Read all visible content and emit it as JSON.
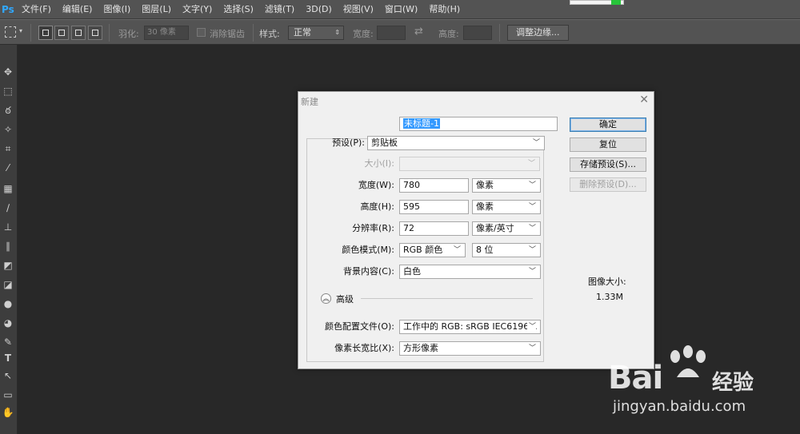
{
  "app": {
    "logo": "Ps"
  },
  "menu": [
    "文件(F)",
    "编辑(E)",
    "图像(I)",
    "图层(L)",
    "文字(Y)",
    "选择(S)",
    "滤镜(T)",
    "3D(D)",
    "视图(V)",
    "窗口(W)",
    "帮助(H)"
  ],
  "options": {
    "feather_label": "羽化:",
    "feather_value": "30 像素",
    "antialias_label": "消除锯齿",
    "style_label": "样式:",
    "style_value": "正常",
    "width_label": "宽度:",
    "height_label": "高度:",
    "refine_edge": "调整边缘..."
  },
  "dialog": {
    "title": "新建",
    "name_value": "未标题-1",
    "preset_label": "预设(P):",
    "preset_value": "剪贴板",
    "size_label": "大小(I):",
    "width_label": "宽度(W):",
    "width_value": "780",
    "width_unit": "像素",
    "height_label": "高度(H):",
    "height_value": "595",
    "height_unit": "像素",
    "resolution_label": "分辨率(R):",
    "resolution_value": "72",
    "resolution_unit": "像素/英寸",
    "color_mode_label": "颜色模式(M):",
    "color_mode_value": "RGB 颜色",
    "bit_depth_value": "8 位",
    "background_label": "背景内容(C):",
    "background_value": "白色",
    "advanced_label": "高级",
    "color_profile_label": "颜色配置文件(O):",
    "color_profile_value": "工作中的 RGB: sRGB IEC6196...",
    "pixel_aspect_label": "像素长宽比(X):",
    "pixel_aspect_value": "方形像素",
    "ok_label": "确定",
    "reset_label": "复位",
    "save_preset_label": "存储预设(S)...",
    "delete_preset_label": "删除预设(D)...",
    "image_size_label": "图像大小:",
    "image_size_value": "1.33M"
  },
  "watermark": {
    "brand": "Bai",
    "brand_tail": "经验",
    "url": "jingyan.baidu.com"
  },
  "colors": {
    "accent": "#3399ff",
    "menubar": "#535353",
    "canvas": "#282828",
    "dialog": "#f0f0f0"
  }
}
